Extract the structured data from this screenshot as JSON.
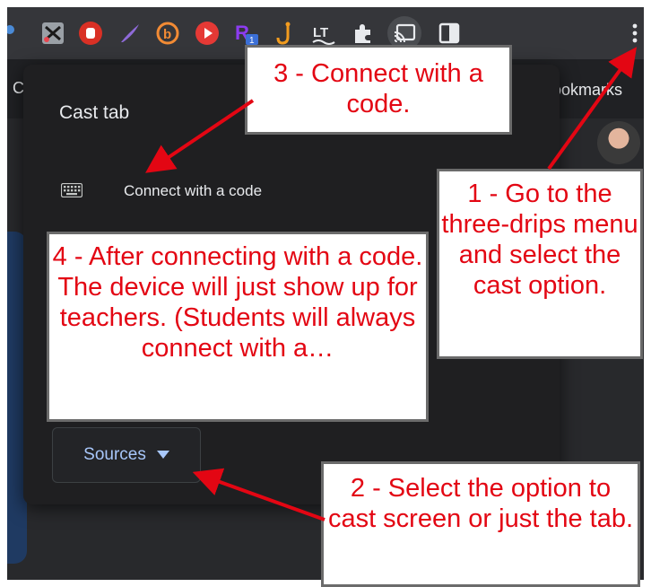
{
  "tabstrip": {
    "left_text": "C",
    "bookmarks": "ookmarks",
    "close_glyph": "×"
  },
  "panel": {
    "title": "Cast tab",
    "connect_code_label": "Connect with a code",
    "sources_label": "Sources"
  },
  "callouts": {
    "step3": "3 - Connect with a code.",
    "step1": "1 - Go to the three-drips menu and select the cast option.",
    "step4": "4 - After connecting with a code. The device will just show up for teachers. (Students will always connect with a…",
    "step2": "2 - Select the option to cast screen or just the tab."
  },
  "colors": {
    "annotation_red": "#e30613",
    "link_blue": "#a8c7fa"
  },
  "icons": [
    "scissors-ext-icon",
    "stop-hand-ext-icon",
    "feather-ext-icon",
    "b-ext-icon",
    "play-ext-icon",
    "p-ext-icon",
    "hook-ext-icon",
    "lt-ext-icon",
    "puzzle-icon",
    "cast-icon",
    "side-panel-icon",
    "kebab-menu-icon"
  ]
}
